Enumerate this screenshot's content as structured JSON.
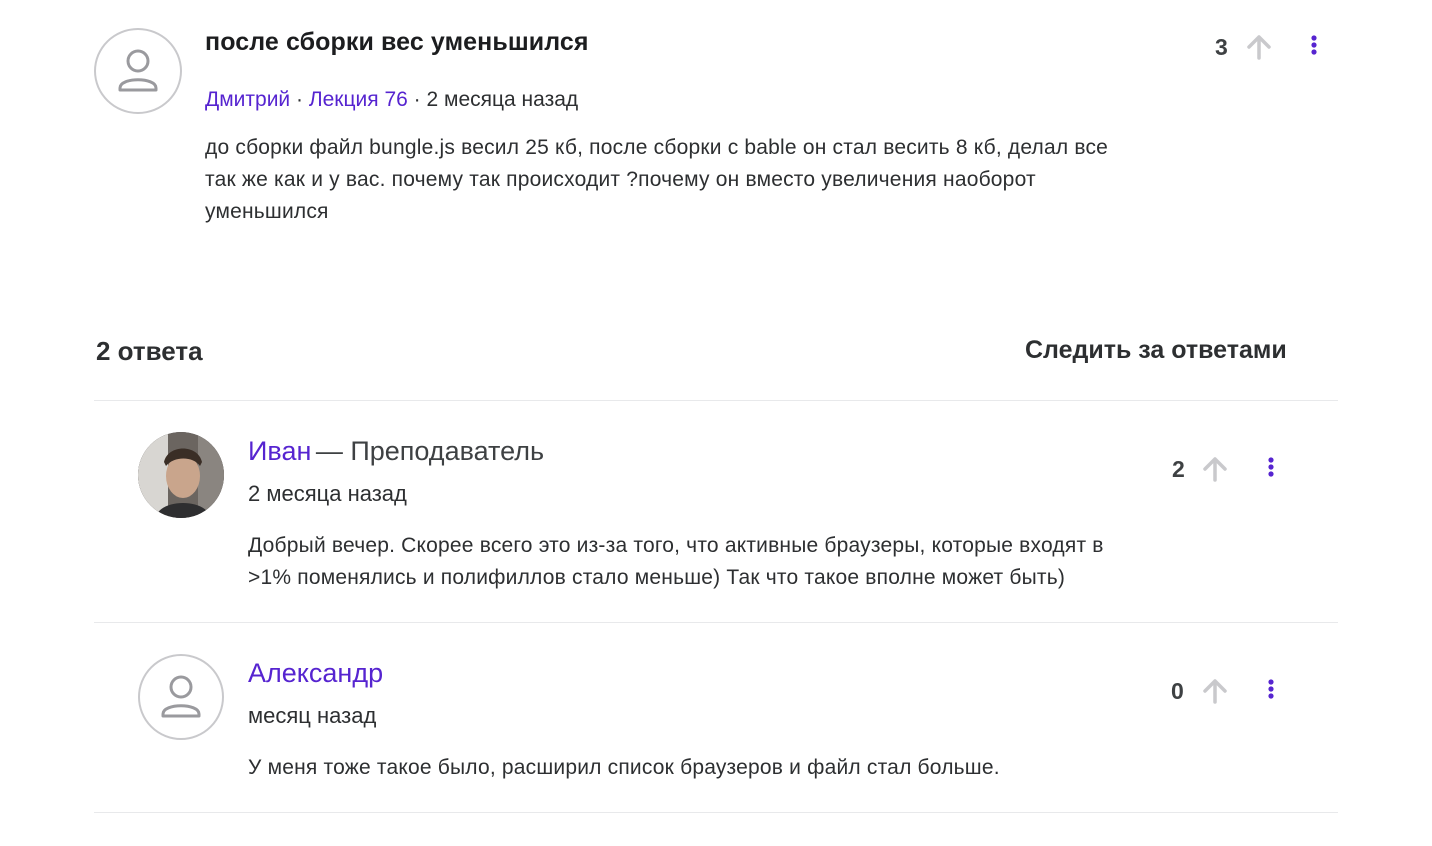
{
  "question": {
    "title": "после сборки вес уменьшился",
    "author": "Дмитрий",
    "lecture": "Лекция 76",
    "separator": "·",
    "time": "2 месяца назад",
    "body_lines": [
      "до сборки файл bungle.js весил 25 кб, после сборки с bable он стал весить 8 кб, делал все",
      "так же как и у вас. почему так происходит ?почему он вместо увеличения наоборот",
      "уменьшился"
    ],
    "votes": "3"
  },
  "answers_header": {
    "count_label": "2 ответа",
    "follow_label": "Следить за ответами"
  },
  "answers": [
    {
      "name": "Иван",
      "role": "— Преподаватель",
      "time": "2 месяца назад",
      "body_lines": [
        "Добрый вечер. Скорее всего это из-за того, что активные браузеры, которые входят в",
        ">1% поменялись и полифиллов стало меньше) Так что такое вполне может быть)"
      ],
      "votes": "2"
    },
    {
      "name": "Александр",
      "time": "месяц назад",
      "body_lines": [
        "У меня тоже такое было, расширил список браузеров и файл стал больше."
      ],
      "votes": "0"
    }
  ],
  "colors": {
    "accent": "#5624d0",
    "text": "#2d2f31",
    "icon_muted": "#c9c9cc",
    "divider": "#e8e9eb"
  },
  "icons": {
    "avatar_placeholder": "user-icon",
    "upvote": "arrow-up-icon",
    "menu": "kebab-menu-icon"
  }
}
